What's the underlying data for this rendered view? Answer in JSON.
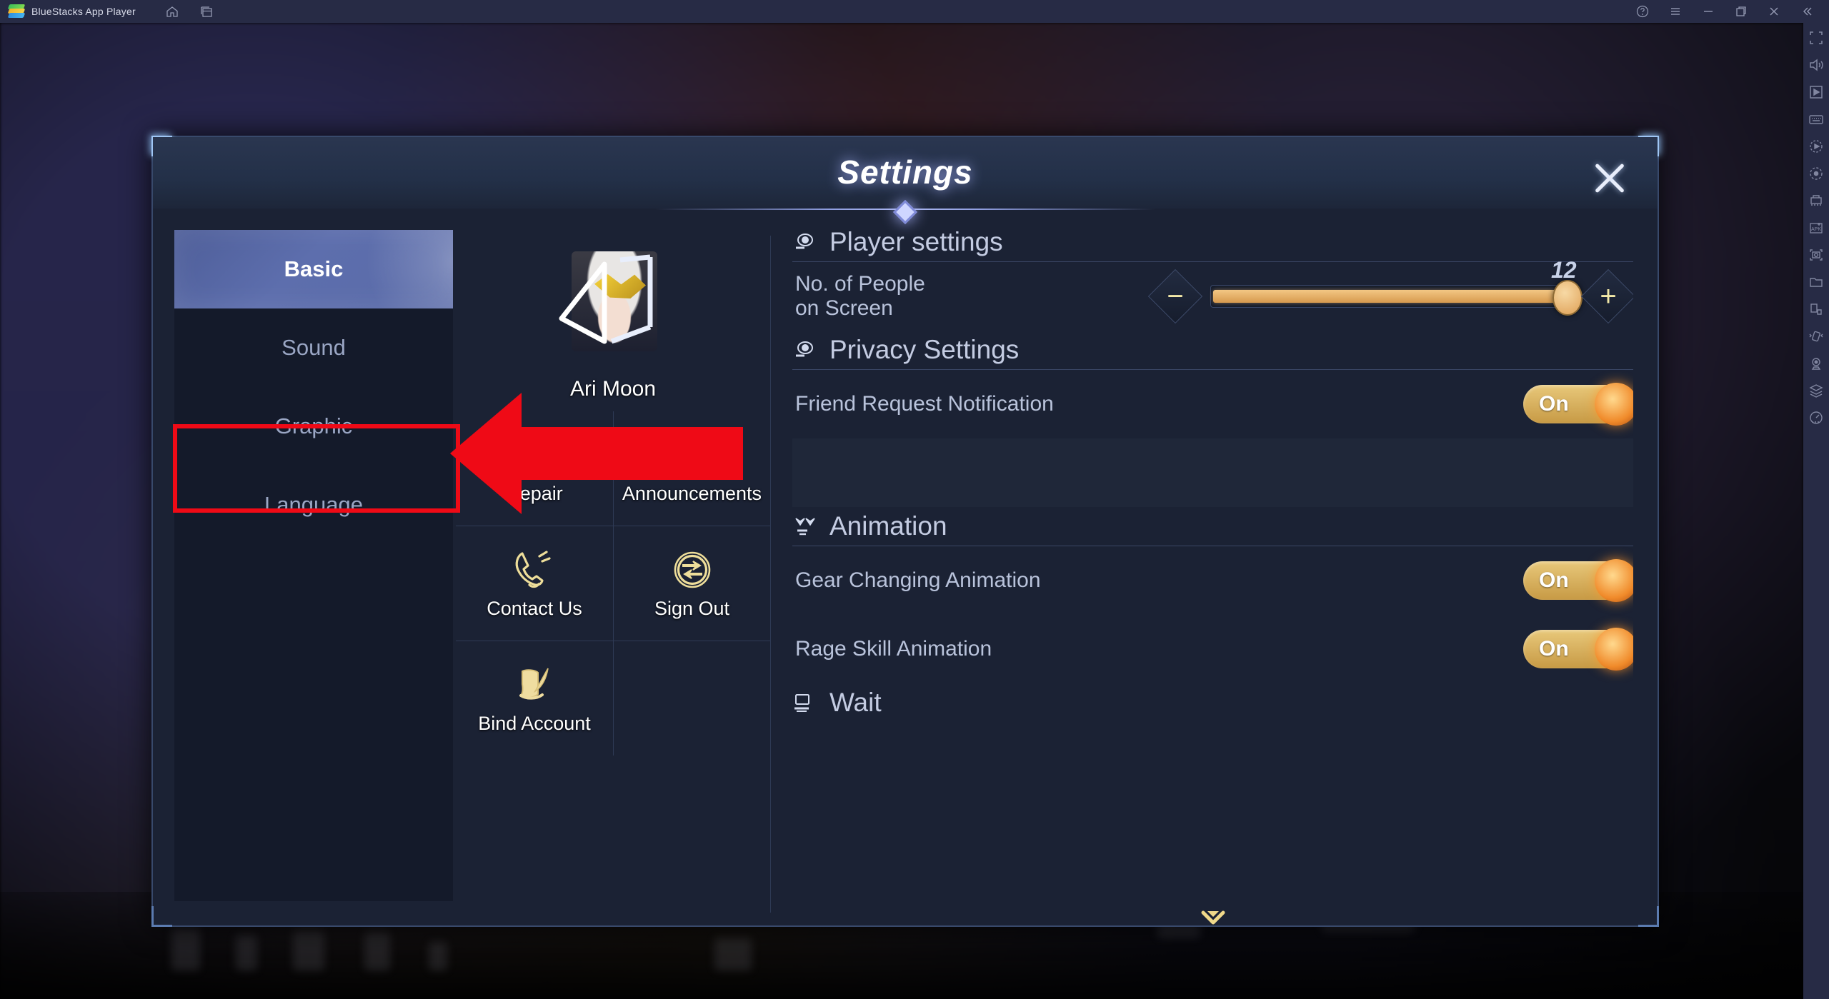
{
  "window": {
    "app_title": "BlueStacks App Player",
    "left_icons": [
      {
        "name": "home-icon",
        "label": "Home"
      },
      {
        "name": "instance-manager-icon",
        "label": "Instance Manager"
      }
    ],
    "right_controls": [
      {
        "name": "help-icon",
        "label": "Help"
      },
      {
        "name": "menu-icon",
        "label": "Menu"
      },
      {
        "name": "minimize-icon",
        "label": "Minimize"
      },
      {
        "name": "maximize-icon",
        "label": "Maximize"
      },
      {
        "name": "close-icon",
        "label": "Close"
      },
      {
        "name": "collapse-sidebar-icon",
        "label": "Collapse"
      }
    ]
  },
  "rail": {
    "items": [
      {
        "name": "fullscreen-icon",
        "label": "Full screen"
      },
      {
        "name": "volume-icon",
        "label": "Volume"
      },
      {
        "name": "game-controls-icon",
        "label": "Game controls"
      },
      {
        "name": "keyboard-icon",
        "label": "Keyboard controls"
      },
      {
        "name": "macro-recorder-icon",
        "label": "Macro recorder"
      },
      {
        "name": "screen-record-icon",
        "label": "Screen record"
      },
      {
        "name": "multi-instance-icon",
        "label": "Multi-instance"
      },
      {
        "name": "install-apk-icon",
        "label": "Install APK"
      },
      {
        "name": "screenshot-icon",
        "label": "Screenshot"
      },
      {
        "name": "media-manager-icon",
        "label": "Media manager"
      },
      {
        "name": "rotate-screen-icon",
        "label": "Rotate"
      },
      {
        "name": "shake-icon",
        "label": "Shake"
      },
      {
        "name": "location-icon",
        "label": "Location"
      },
      {
        "name": "layers-icon",
        "label": "Eco mode"
      },
      {
        "name": "performance-icon",
        "label": "Performance"
      }
    ]
  },
  "dialog": {
    "title": "Settings",
    "close_label": "Close",
    "sidebar": {
      "items": [
        {
          "label": "Basic",
          "active": true
        },
        {
          "label": "Sound",
          "active": false
        },
        {
          "label": "Graphic",
          "active": false
        },
        {
          "label": "Language",
          "active": false
        }
      ]
    },
    "account": {
      "name": "Ari Moon",
      "avatar_name": "player-avatar",
      "menu": [
        {
          "label": "Repair",
          "icon": "wrench-icon"
        },
        {
          "label": "Announcements",
          "icon": "megaphone-icon"
        },
        {
          "label": "Contact Us",
          "icon": "phone-icon"
        },
        {
          "label": "Sign Out",
          "icon": "sign-out-icon"
        },
        {
          "label": "Bind Account",
          "icon": "scroll-quill-icon"
        }
      ]
    },
    "sections": [
      {
        "title": "Player settings",
        "icon": "eye-icon",
        "rows": [
          {
            "type": "slider",
            "label_line1": "No. of People",
            "label_line2": "on Screen",
            "value": "12",
            "fill_percent": 100,
            "minus_label": "−",
            "plus_label": "+"
          }
        ]
      },
      {
        "title": "Privacy Settings",
        "icon": "eye-icon",
        "rows": [
          {
            "type": "toggle",
            "label": "Friend Request Notification",
            "value": "On"
          },
          {
            "type": "empty",
            "label": ""
          }
        ]
      },
      {
        "title": "Animation",
        "icon": "animation-icon",
        "rows": [
          {
            "type": "toggle",
            "label": "Gear Changing Animation",
            "value": "On"
          },
          {
            "type": "toggle",
            "label": "Rage Skill Animation",
            "value": "On"
          }
        ]
      },
      {
        "title": "Wait",
        "icon": "monitor-icon",
        "rows": []
      }
    ],
    "scroll_hint": "scroll-down-chevron"
  },
  "annotation": {
    "highlight_target": "Graphic",
    "arrow_color": "#EF0A16",
    "box_color": "#EF0A16"
  },
  "colors": {
    "accent_gold": "#E0A74F",
    "toggle_on": "#D7A44B",
    "dialog_bg": "#1B2234",
    "sidebar_active": "#5A6BA8",
    "chrome_bg": "#272B45"
  }
}
